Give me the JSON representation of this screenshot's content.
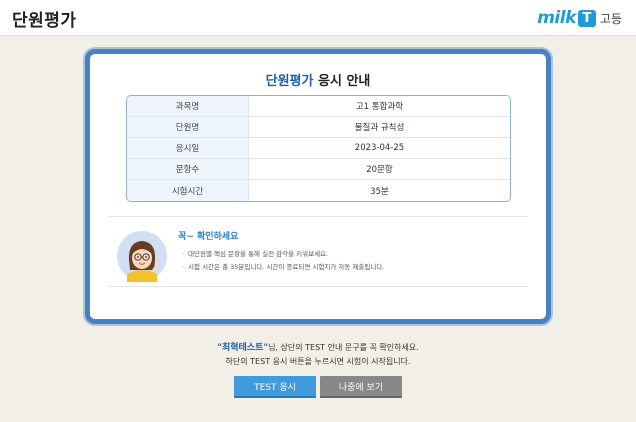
{
  "header": {
    "title": "단원평가",
    "brand": {
      "milk": "milk",
      "t": "T",
      "sub": "고등"
    }
  },
  "card": {
    "title_accent": "단원평가",
    "title_rest": " 응시 안내",
    "info_rows": [
      {
        "label": "과목명",
        "value": "고1 통합과학"
      },
      {
        "label": "단원명",
        "value": "물질과 규칙성"
      },
      {
        "label": "응시일",
        "value": "2023-04-25"
      },
      {
        "label": "문항수",
        "value": "20문항"
      },
      {
        "label": "시험시간",
        "value": "35분"
      }
    ],
    "notice": {
      "title": "꼭~ 확인하세요",
      "items": [
        "ㆍ 대단원별 핵심 문항을 통해 실전 감각을 키워보세요.",
        "ㆍ 시험 시간은 총 35분입니다. 시간이 종료되면 시험지가 자동 제출됩니다."
      ]
    }
  },
  "footer": {
    "name_quoted": "\"최혁테스트\"",
    "line1_rest": "님, 상단의 TEST 안내 문구를 꼭 확인하세요.",
    "line2": "하단의 TEST 응시 버튼을 누르시면 시험이 시작됩니다."
  },
  "buttons": {
    "test_label": "TEST 응시",
    "later_label": "나중에 보기"
  },
  "colors": {
    "accent_blue": "#1f5ea8",
    "card_border": "#4a7fc0",
    "test_button": "#3f9bdc",
    "later_button": "#888888",
    "notice_title": "#2a7fd2"
  }
}
